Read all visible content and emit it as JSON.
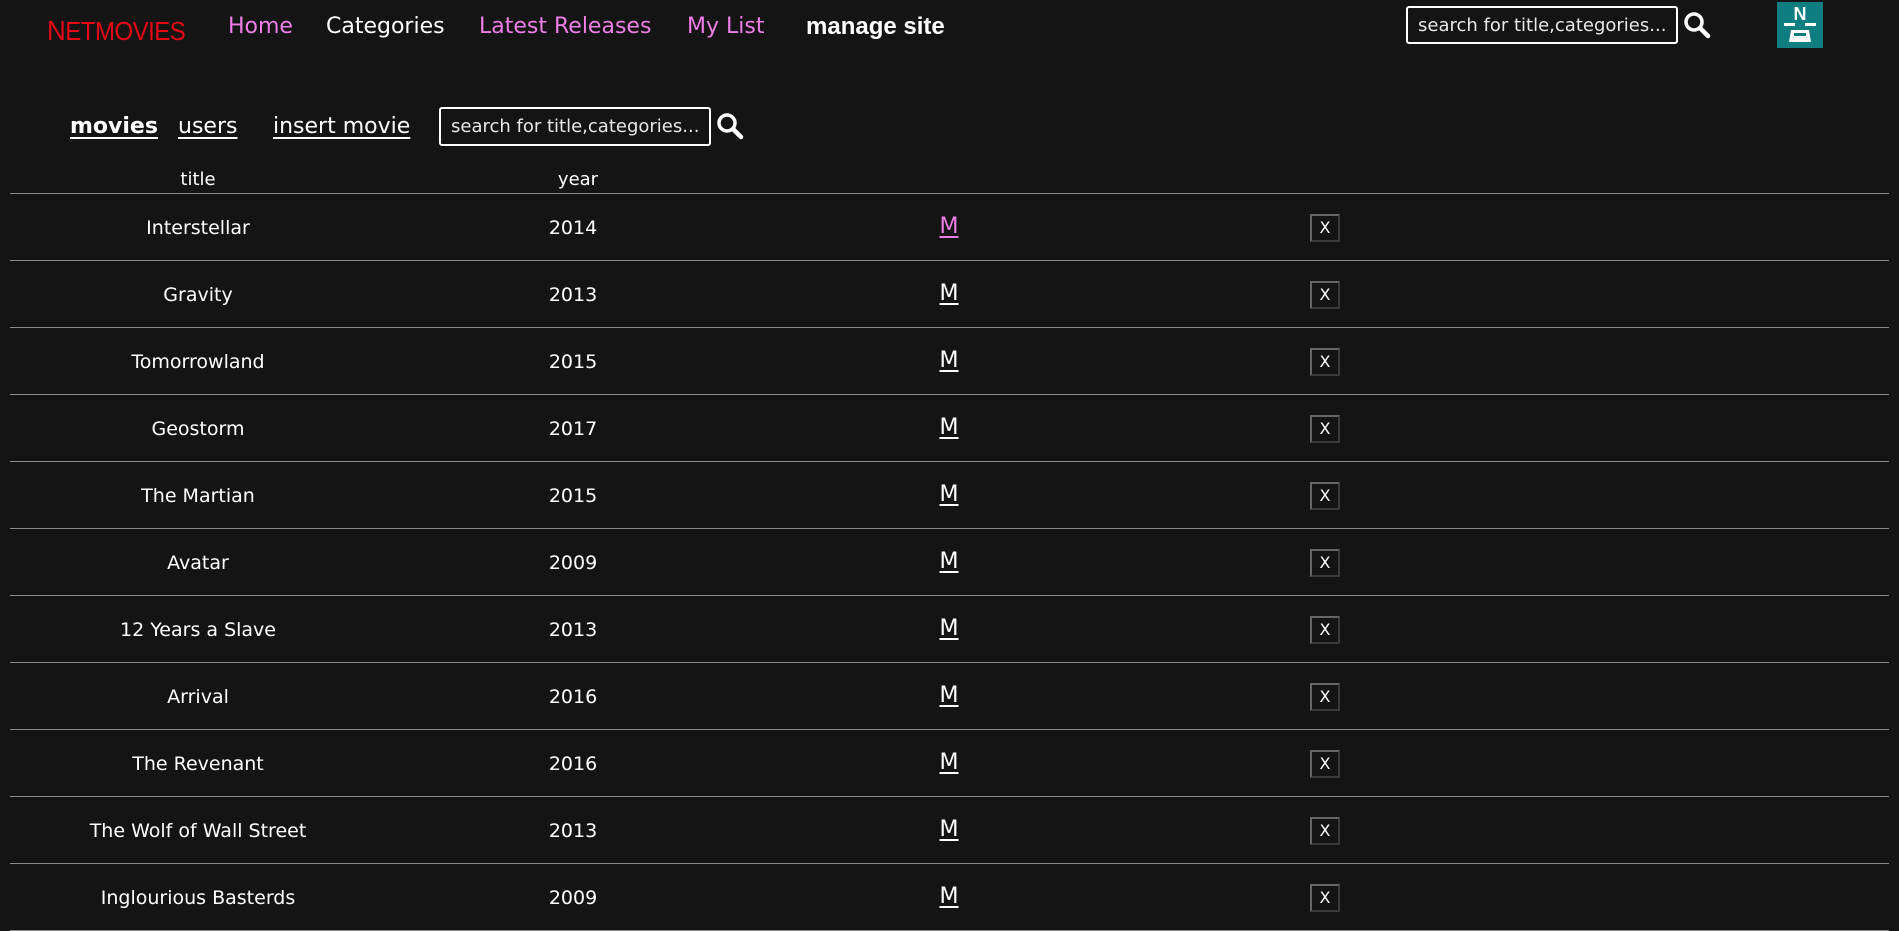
{
  "header": {
    "logo": "NETMOVIES",
    "logo_initial": "N",
    "logo_rest": "ETMOVIES",
    "nav": [
      {
        "label": "Home"
      },
      {
        "label": "Categories"
      },
      {
        "label": "Latest Releases"
      },
      {
        "label": "My List"
      },
      {
        "label": "manage site"
      }
    ],
    "search_placeholder": "search for title,categories...",
    "search_icon": "magnifier-icon",
    "avatar_letter": "N"
  },
  "admin": {
    "tabs": [
      {
        "label": "movies",
        "active": true
      },
      {
        "label": "users",
        "active": false
      },
      {
        "label": "insert movie",
        "active": false
      }
    ],
    "search_placeholder": "search for title,categories..."
  },
  "table": {
    "headers": {
      "title": "title",
      "year": "year"
    },
    "modify_label": "M",
    "delete_label": "X",
    "rows": [
      {
        "title": "Interstellar",
        "year": "2014"
      },
      {
        "title": "Gravity",
        "year": "2013"
      },
      {
        "title": "Tomorrowland",
        "year": "2015"
      },
      {
        "title": "Geostorm",
        "year": "2017"
      },
      {
        "title": "The Martian",
        "year": "2015"
      },
      {
        "title": "Avatar",
        "year": "2009"
      },
      {
        "title": "12 Years a Slave",
        "year": "2013"
      },
      {
        "title": "Arrival",
        "year": "2016"
      },
      {
        "title": "The Revenant",
        "year": "2016"
      },
      {
        "title": "The Wolf of Wall Street",
        "year": "2013"
      },
      {
        "title": "Inglourious Basterds",
        "year": "2009"
      }
    ]
  },
  "colors": {
    "background": "#141414",
    "brand": "#e50914",
    "accent_pink": "#ee7ee6",
    "avatar": "#0f7e80"
  }
}
